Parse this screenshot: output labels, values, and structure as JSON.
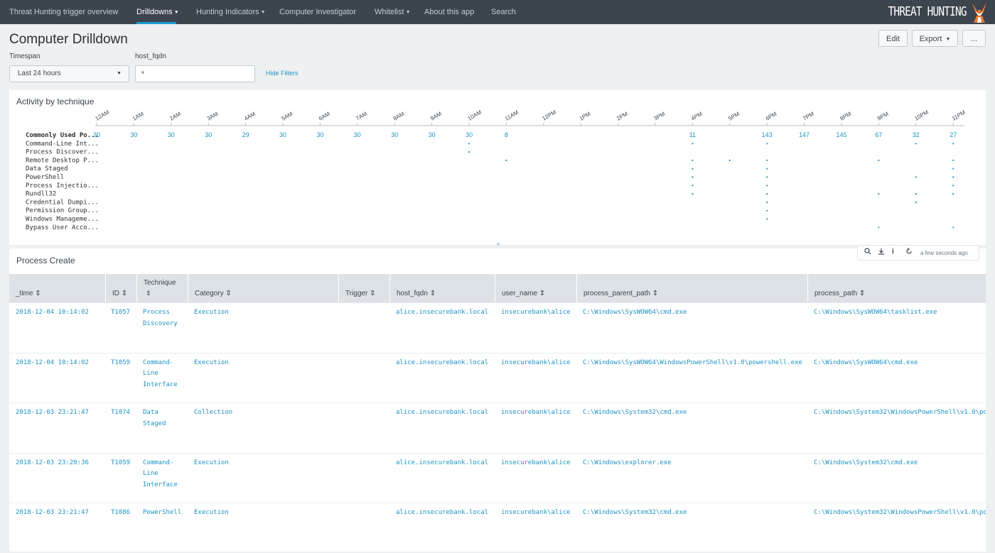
{
  "nav": {
    "items": [
      {
        "label": "Threat Hunting trigger overview",
        "dropdown": false,
        "active": false
      },
      {
        "label": "Drilldowns",
        "dropdown": true,
        "active": true
      },
      {
        "label": "Hunting Indicators",
        "dropdown": true,
        "active": false
      },
      {
        "label": "Computer Investigator",
        "dropdown": false,
        "active": false
      },
      {
        "label": "Whitelist",
        "dropdown": true,
        "active": false
      },
      {
        "label": "About this app",
        "dropdown": false,
        "active": false
      },
      {
        "label": "Search",
        "dropdown": false,
        "active": false
      }
    ],
    "brand": "THREAT HUNTING",
    "brand_icon": "fox-logo-icon"
  },
  "page": {
    "title": "Computer Drilldown",
    "edit_label": "Edit",
    "export_label": "Export",
    "more_label": "..."
  },
  "filters": {
    "timespan_label": "Timespan",
    "timespan_value": "Last 24 hours",
    "host_label": "host_fqdn",
    "host_value": "*",
    "hide_label": "Hide Filters"
  },
  "activity": {
    "title": "Activity by technique",
    "hours": [
      "12AM",
      "1AM",
      "2AM",
      "3AM",
      "4AM",
      "5AM",
      "6AM",
      "7AM",
      "8AM",
      "9AM",
      "10AM",
      "11AM",
      "12PM",
      "1PM",
      "2PM",
      "3PM",
      "4PM",
      "5PM",
      "6PM",
      "7PM",
      "8PM",
      "9PM",
      "10PM",
      "11PM"
    ],
    "techniques": [
      "Commonly Used Po...",
      "Command-Line Int...",
      "Process Discover...",
      "Remote Desktop P...",
      "Data Staged",
      "PowerShell",
      "Process Injectio...",
      "Rundll32",
      "Credential Dumpi...",
      "Permission Group...",
      "Windows Manageme...",
      "Bypass User Acco..."
    ],
    "top_counts": [
      "30",
      "30",
      "30",
      "30",
      "29",
      "30",
      "30",
      "30",
      "30",
      "30",
      "30",
      "8",
      "",
      "",
      "",
      "",
      "11",
      "",
      "143",
      "147",
      "145",
      "67",
      "32",
      "27"
    ],
    "cells": [
      [
        1,
        10
      ],
      [
        1,
        16
      ],
      [
        1,
        18
      ],
      [
        1,
        22
      ],
      [
        1,
        23
      ],
      [
        2,
        10
      ],
      [
        3,
        11
      ],
      [
        3,
        16
      ],
      [
        3,
        17
      ],
      [
        3,
        18
      ],
      [
        3,
        21
      ],
      [
        3,
        23
      ],
      [
        4,
        16
      ],
      [
        4,
        18
      ],
      [
        4,
        23
      ],
      [
        5,
        16
      ],
      [
        5,
        18
      ],
      [
        5,
        22
      ],
      [
        5,
        23
      ],
      [
        6,
        16
      ],
      [
        6,
        18
      ],
      [
        6,
        23
      ],
      [
        7,
        16
      ],
      [
        7,
        18
      ],
      [
        7,
        21
      ],
      [
        7,
        22
      ],
      [
        7,
        23
      ],
      [
        8,
        18
      ],
      [
        8,
        22
      ],
      [
        9,
        18
      ],
      [
        10,
        18
      ],
      [
        11,
        21
      ],
      [
        11,
        23
      ]
    ]
  },
  "process": {
    "title": "Process Create",
    "tools": {
      "search_icon": "search-icon",
      "download_icon": "download-icon",
      "info_icon": "info-icon",
      "refresh_icon": "refresh-icon",
      "updated": "a few seconds ago"
    },
    "columns": [
      "_time",
      "ID",
      "Technique",
      "Category",
      "Trigger",
      "host_fqdn",
      "user_name",
      "process_parent_path",
      "process_path"
    ],
    "rows": [
      {
        "time": "2018-12-04 10:14:02",
        "id": "T1057",
        "technique": "Process Discovery",
        "category": "Execution",
        "trigger": "",
        "host": "alice.insecurebank.local",
        "user": "insecurebank\\alice",
        "parent": "C:\\Windows\\SysWOW64\\cmd.exe",
        "path": "C:\\Windows\\SysWOW64\\tasklist.exe"
      },
      {
        "time": "2018-12-04 10:14:02",
        "id": "T1059",
        "technique": "Command-Line Interface",
        "category": "Execution",
        "trigger": "",
        "host": "alice.insecurebank.local",
        "user": "insecurebank\\alice",
        "parent": "C:\\Windows\\SysWOW64\\WindowsPowerShell\\v1.0\\powershell.exe",
        "path": "C:\\Windows\\SysWOW64\\cmd.exe"
      },
      {
        "time": "2018-12-03 23:21:47",
        "id": "T1074",
        "technique": "Data Staged",
        "category": "Collection",
        "trigger": "",
        "host": "alice.insecurebank.local",
        "user": "insecurebank\\alice",
        "parent": "C:\\Windows\\System32\\cmd.exe",
        "path": "C:\\Windows\\System32\\WindowsPowerShell\\v1.0\\po"
      },
      {
        "time": "2018-12-03 23:20:36",
        "id": "T1059",
        "technique": "Command-Line Interface",
        "category": "Execution",
        "trigger": "",
        "host": "alice.insecurebank.local",
        "user": "insecurebank\\alice",
        "parent": "C:\\Windows\\explorer.exe",
        "path": "C:\\Windows\\System32\\cmd.exe"
      },
      {
        "time": "2018-12-03 23:21:47",
        "id": "T1086",
        "technique": "PowerShell",
        "category": "Execution",
        "trigger": "",
        "host": "alice.insecurebank.local",
        "user": "insecurebank\\alice",
        "parent": "C:\\Windows\\System32\\cmd.exe",
        "path": "C:\\Windows\\System32\\WindowsPowerShell\\v1.0\\po"
      }
    ]
  },
  "colors": {
    "nav_bg": "#3c444d",
    "link": "#1e93c6",
    "accent": "#1a9cd1",
    "header_bg": "#dde2e6",
    "page_bg": "#eef0f1"
  }
}
